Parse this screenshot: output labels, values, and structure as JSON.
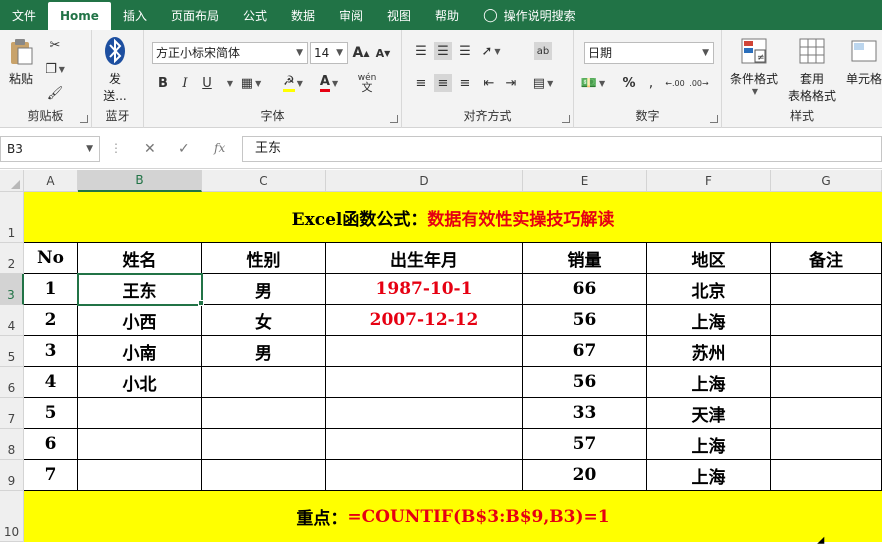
{
  "ribbon_tabs": [
    "文件",
    "Home",
    "插入",
    "页面布局",
    "公式",
    "数据",
    "审阅",
    "视图",
    "帮助",
    "操作说明搜索"
  ],
  "clipboard": {
    "paste_label": "粘贴",
    "group_label": "剪贴板"
  },
  "bluetooth": {
    "send_label_1": "发",
    "send_label_2": "送...",
    "group_label": "蓝牙"
  },
  "font": {
    "name": "方正小标宋简体",
    "size": "14",
    "group_label": "字体",
    "bold": "B",
    "italic": "I",
    "underline": "U",
    "grow": "A",
    "shrink": "A",
    "phonetic": "wén"
  },
  "alignment": {
    "group_label": "对齐方式"
  },
  "number": {
    "format": "日期",
    "group_label": "数字"
  },
  "styles": {
    "conditional_label": "条件格式",
    "table_label_1": "套用",
    "table_label_2": "表格格式",
    "cell_label": "单元格",
    "group_label": "样式"
  },
  "formula_bar": {
    "cell_ref": "B3",
    "content": "王东",
    "fx": "fx"
  },
  "columns": [
    "A",
    "B",
    "C",
    "D",
    "E",
    "F",
    "G"
  ],
  "rows": [
    "1",
    "2",
    "3",
    "4",
    "5",
    "6",
    "7",
    "8",
    "9",
    "10"
  ],
  "title": {
    "prefix": "Excel函数公式：",
    "main": "数据有效性实操技巧解读"
  },
  "table": {
    "headers": [
      "No",
      "姓名",
      "性别",
      "出生年月",
      "销量",
      "地区",
      "备注"
    ],
    "rows": [
      [
        "1",
        "王东",
        "男",
        "1987-10-1",
        "66",
        "北京",
        ""
      ],
      [
        "2",
        "小西",
        "女",
        "2007-12-12",
        "56",
        "上海",
        ""
      ],
      [
        "3",
        "小南",
        "男",
        "",
        "67",
        "苏州",
        ""
      ],
      [
        "4",
        "小北",
        "",
        "",
        "56",
        "上海",
        ""
      ],
      [
        "5",
        "",
        "",
        "",
        "33",
        "天津",
        ""
      ],
      [
        "6",
        "",
        "",
        "",
        "57",
        "上海",
        ""
      ],
      [
        "7",
        "",
        "",
        "",
        "20",
        "上海",
        ""
      ]
    ]
  },
  "footer": {
    "prefix": "重点：",
    "formula": "=COUNTIF(B$3:B$9,B3)=1"
  },
  "colors": {
    "ribbon": "#217346",
    "highlight": "#ffff00",
    "red_text": "#e60012"
  }
}
